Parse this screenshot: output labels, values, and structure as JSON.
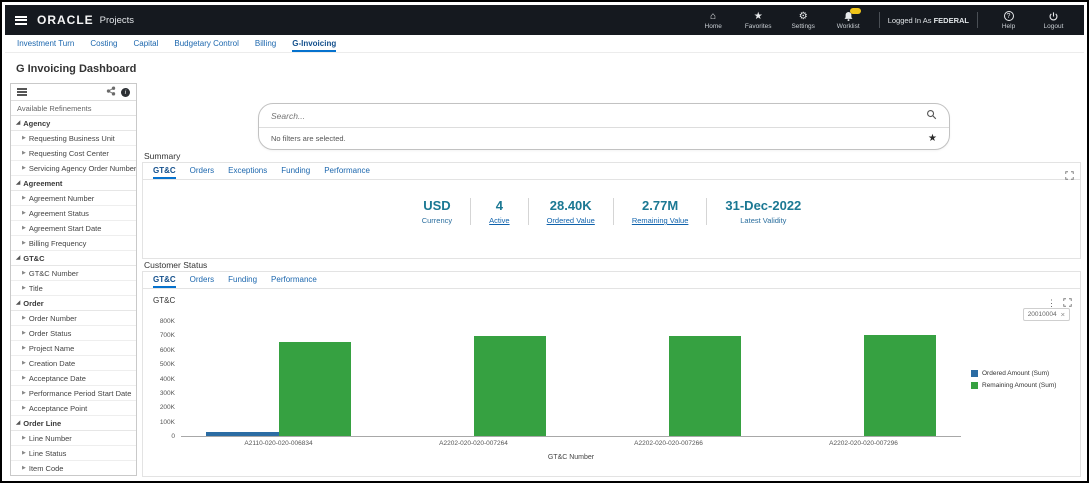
{
  "colors": {
    "header_bg": "#15191f",
    "accent_blue": "#0572ce",
    "metric_teal": "#1b7893",
    "bar_blue": "#2b6ca3",
    "bar_green": "#36a141",
    "badge_yellow": "#f0c419"
  },
  "icons": {
    "home": "⌂",
    "star": "★",
    "gear": "⚙",
    "help": "?",
    "info": "i",
    "kebab": "⋮",
    "close": "×",
    "favorite_star": "★",
    "group_expanded_marker": "◢",
    "item_marker": "▶"
  },
  "header": {
    "brand": "ORACLE",
    "app": "Projects",
    "items": [
      {
        "label": "Home"
      },
      {
        "label": "Favorites"
      },
      {
        "label": "Settings"
      },
      {
        "label": "Worklist"
      }
    ],
    "logged_in_prefix": "Logged In As",
    "logged_in_user": "FEDERAL",
    "help_label": "Help",
    "logout_label": "Logout"
  },
  "nav_tabs": [
    {
      "label": "Investment Turn",
      "active": false
    },
    {
      "label": "Costing",
      "active": false
    },
    {
      "label": "Capital",
      "active": false
    },
    {
      "label": "Budgetary Control",
      "active": false
    },
    {
      "label": "Billing",
      "active": false
    },
    {
      "label": "G-Invoicing",
      "active": true
    }
  ],
  "page_title": "G Invoicing Dashboard",
  "sidebar": {
    "title": "Available Refinements",
    "groups": [
      {
        "label": "Agency",
        "items": [
          "Requesting Business Unit",
          "Requesting Cost Center",
          "Servicing Agency Order Number"
        ]
      },
      {
        "label": "Agreement",
        "items": [
          "Agreement Number",
          "Agreement Status",
          "Agreement Start Date",
          "Billing Frequency"
        ]
      },
      {
        "label": "GT&C",
        "items": [
          "GT&C Number",
          "Title"
        ]
      },
      {
        "label": "Order",
        "items": [
          "Order Number",
          "Order Status",
          "Project Name",
          "Creation Date",
          "Acceptance Date",
          "Performance Period Start Date",
          "Acceptance Point"
        ]
      },
      {
        "label": "Order Line",
        "items": [
          "Line Number",
          "Line Status",
          "Item Code"
        ]
      }
    ]
  },
  "search": {
    "placeholder": "Search...",
    "filters_text": "No filters are selected."
  },
  "summary": {
    "section_label": "Summary",
    "tabs": [
      {
        "label": "GT&C",
        "active": true
      },
      {
        "label": "Orders",
        "active": false
      },
      {
        "label": "Exceptions",
        "active": false
      },
      {
        "label": "Funding",
        "active": false
      },
      {
        "label": "Performance",
        "active": false
      }
    ],
    "metrics": [
      {
        "value": "USD",
        "label": "Currency",
        "link": false
      },
      {
        "value": "4",
        "label": "Active",
        "link": true
      },
      {
        "value": "28.40K",
        "label": "Ordered Value",
        "link": true
      },
      {
        "value": "2.77M",
        "label": "Remaining Value",
        "link": true
      },
      {
        "value": "31-Dec-2022",
        "label": "Latest Validity",
        "link": false
      }
    ]
  },
  "customer_status": {
    "section_label": "Customer Status",
    "tabs": [
      {
        "label": "GT&C",
        "active": true
      },
      {
        "label": "Orders",
        "active": false
      },
      {
        "label": "Funding",
        "active": false
      },
      {
        "label": "Performance",
        "active": false
      }
    ],
    "filter_chip": {
      "label": "20010004"
    }
  },
  "chart_data": {
    "type": "bar",
    "title": "GT&C",
    "categories": [
      "A2110-020-020-006834",
      "A2202-020-020-007264",
      "A2202-020-020-007266",
      "A2202-020-020-007296"
    ],
    "series": [
      {
        "name": "Ordered Amount (Sum)",
        "color": "#2b6ca3",
        "values": [
          28400,
          0,
          0,
          0
        ]
      },
      {
        "name": "Remaining Amount (Sum)",
        "color": "#36a141",
        "values": [
          660000,
          700000,
          700000,
          710000
        ]
      }
    ],
    "xlabel": "GT&C Number",
    "ylabel": "",
    "ylim": [
      0,
      800000
    ],
    "yticks": [
      "0",
      "100K",
      "200K",
      "300K",
      "400K",
      "500K",
      "600K",
      "700K",
      "800K"
    ],
    "grid": false,
    "legend_position": "right"
  }
}
